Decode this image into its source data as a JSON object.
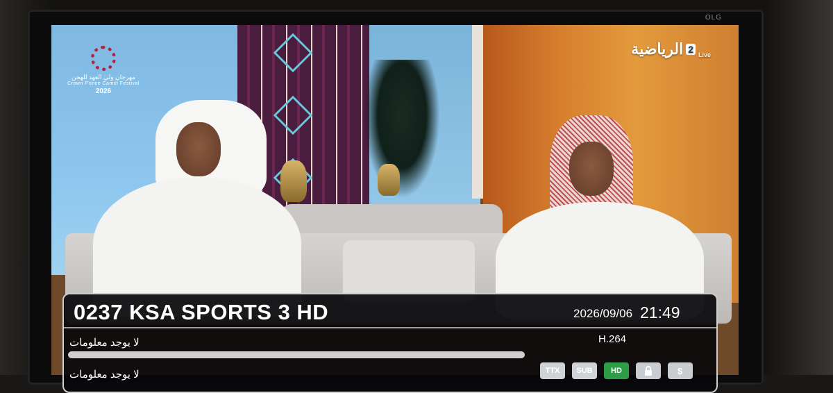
{
  "tv": {
    "brand": "OLG"
  },
  "overlay": {
    "festival_logo": {
      "arabic": "مهرجان ولي العهد للهجن",
      "english": "Crown Prince Camel Festival",
      "year": "2026"
    },
    "channel_logo": {
      "number": "2",
      "name_arabic": "الرياضية",
      "live": "Live"
    }
  },
  "info_banner": {
    "channel": "0237 KSA SPORTS 3 HD",
    "date": "2026/09/06",
    "time": "21:49",
    "codec": "H.264",
    "now_event": "لا يوجد معلومات",
    "next_event": "لا يوجد معلومات",
    "progress_fraction": 0.0,
    "badges": [
      {
        "label": "TTX",
        "state": "off"
      },
      {
        "label": "SUB",
        "state": "off"
      },
      {
        "label": "HD",
        "state": "on"
      },
      {
        "label": "lock",
        "icon": "lock-icon",
        "state": "off"
      },
      {
        "label": "$",
        "icon": "dollar-icon",
        "state": "off"
      }
    ]
  },
  "colors": {
    "hd_active": "#2e9d48",
    "badge_inactive": "#cfd3d8"
  }
}
